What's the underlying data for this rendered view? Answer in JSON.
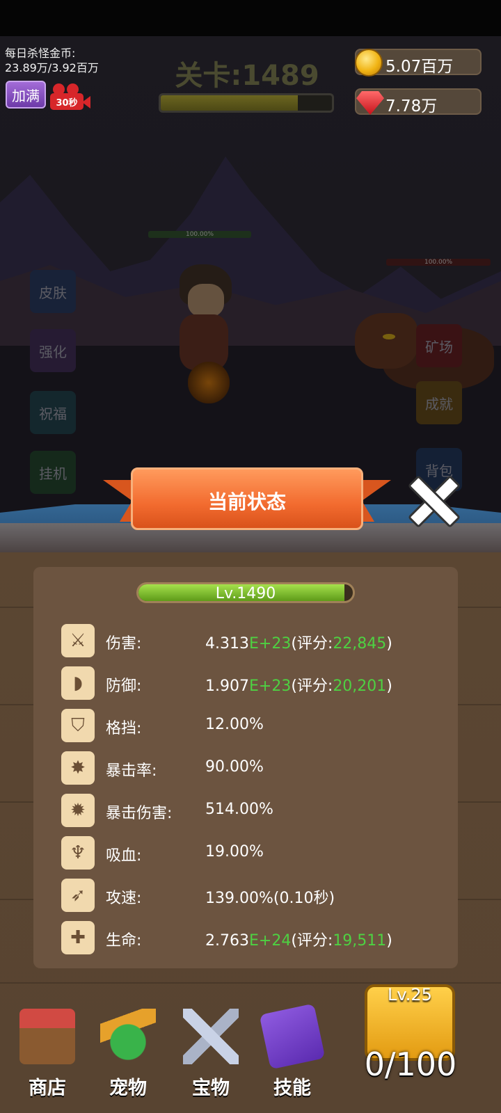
{
  "hud": {
    "daily_label": "每日杀怪金币:",
    "daily_value": "23.89万/3.92百万",
    "fill_button": "加满",
    "video_time": "30秒",
    "stage_title": "关卡:1489",
    "stage_progress": 0.8,
    "gold": "5.07百万",
    "gems": "7.78万"
  },
  "battle": {
    "hero_hp": "100.00%",
    "enemy_hp": "100.00%"
  },
  "side_menu": {
    "left": [
      "皮肤",
      "强化",
      "祝福",
      "挂机"
    ],
    "right": [
      "矿场",
      "成就",
      "背包"
    ]
  },
  "dialog": {
    "title": "当前状态",
    "level": "Lv.1490",
    "level_progress": 0.96,
    "stats": [
      {
        "icon": "sword-icon",
        "label": "伤害:",
        "base": "4.313",
        "exp": "E+23",
        "pre": "(评分:",
        "score": "22,845",
        "post": ")"
      },
      {
        "icon": "shield-icon",
        "label": "防御:",
        "base": "1.907",
        "exp": "E+23",
        "pre": "(评分:",
        "score": "20,201",
        "post": ")"
      },
      {
        "icon": "block-icon",
        "label": "格挡:",
        "base": "12.00%",
        "exp": "",
        "pre": "",
        "score": "",
        "post": ""
      },
      {
        "icon": "crit-rate-icon",
        "label": "暴击率:",
        "base": "90.00%",
        "exp": "",
        "pre": "",
        "score": "",
        "post": ""
      },
      {
        "icon": "crit-damage-icon",
        "label": "暴击伤害:",
        "base": "514.00%",
        "exp": "",
        "pre": "",
        "score": "",
        "post": ""
      },
      {
        "icon": "lifesteal-icon",
        "label": "吸血:",
        "base": "19.00%",
        "exp": "",
        "pre": "",
        "score": "",
        "post": ""
      },
      {
        "icon": "attack-speed-icon",
        "label": "攻速:",
        "base": "139.00%(0.10秒)",
        "exp": "",
        "pre": "",
        "score": "",
        "post": ""
      },
      {
        "icon": "heart-icon",
        "label": "生命:",
        "base": "2.763",
        "exp": "E+24",
        "pre": "(评分:",
        "score": "19,511",
        "post": ")"
      }
    ]
  },
  "dock": {
    "shop": "商店",
    "pet": "宠物",
    "treasure": "宝物",
    "skill": "技能",
    "chest_level": "Lv.25",
    "chest_count": "0/100"
  },
  "colors": {
    "accent_orange": "#f26b2f",
    "stat_green": "#4ed142",
    "panel_brown": "#5b4632"
  }
}
